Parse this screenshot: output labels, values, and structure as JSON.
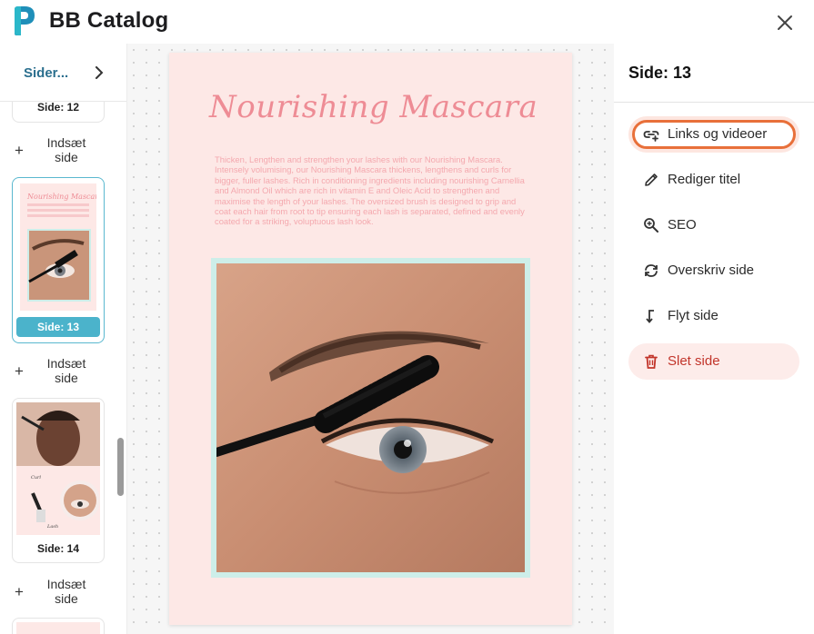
{
  "app": {
    "title": "BB Catalog"
  },
  "sidebar": {
    "title": "Sider...",
    "pages": [
      {
        "label": "Side: 12"
      },
      {
        "label": "Side: 13",
        "active": true
      },
      {
        "label": "Side: 14"
      }
    ],
    "insert_label": "Indsæt side"
  },
  "page": {
    "heading": "Nourishing Mascara",
    "body": "Thicken, Lengthen and strengthen your lashes with our Nourishing Mascara. Intensely volumising, our Nourishing Mascara thickens, lengthens and curls for bigger, fuller lashes. Rich in conditioning ingredients including nourishing Carnellia and Almond Oil which are rich in vitamin E and Oleic Acid to strengthen and maximise the length of your lashes. The oversized brush is designed to grip and coat each hair from root to tip ensuring each lash is separated, defined and evenly coated for a striking, voluptuous lash look."
  },
  "panel": {
    "title": "Side: 13",
    "items": [
      {
        "label": "Links og videoer",
        "icon": "link-add-icon"
      },
      {
        "label": "Rediger titel",
        "icon": "pencil-icon"
      },
      {
        "label": "SEO",
        "icon": "magnifier-icon"
      },
      {
        "label": "Overskriv side",
        "icon": "refresh-icon"
      },
      {
        "label": "Flyt side",
        "icon": "move-arrow-icon"
      },
      {
        "label": "Slet side",
        "icon": "trash-icon"
      }
    ]
  },
  "colors": {
    "accent": "#4bb3cb",
    "brand_blue": "#2b6f8e",
    "focus_ring": "#e8703a",
    "danger": "#c2352b",
    "page_bg": "#fde8e6"
  }
}
